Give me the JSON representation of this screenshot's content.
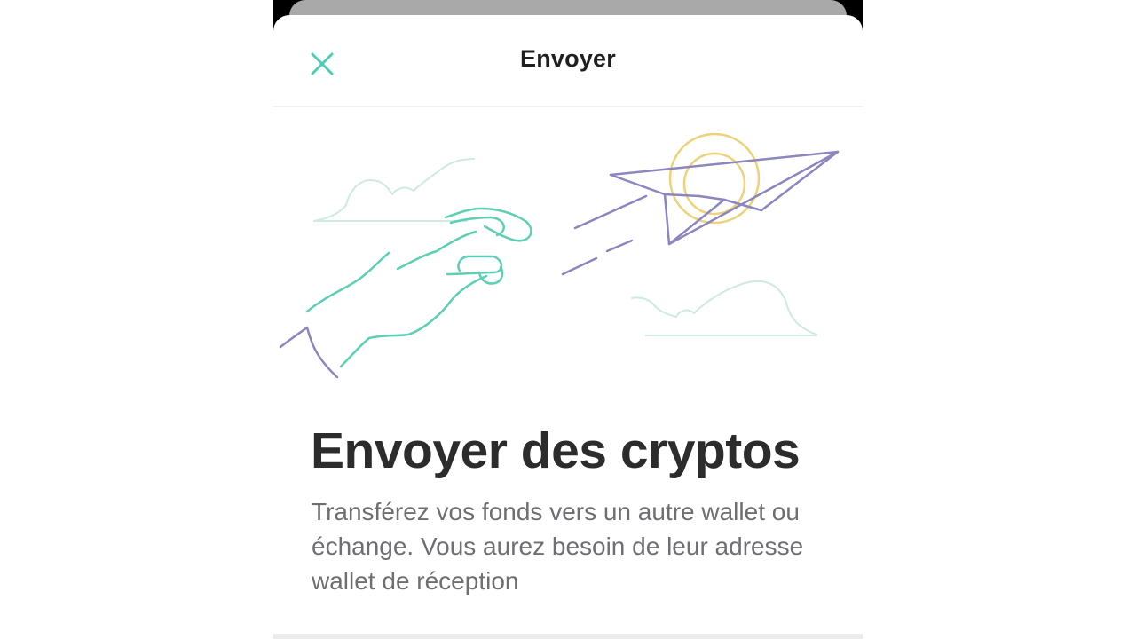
{
  "header": {
    "title": "Envoyer",
    "close_icon": "close-icon"
  },
  "illustration": {
    "icon": "send-crypto-illustration",
    "colors": {
      "hand": "#5ccfb4",
      "plane": "#8c86be",
      "coin": "#ecd27a",
      "cloud": "#cfe9e3"
    }
  },
  "main": {
    "headline": "Envoyer des cryptos",
    "description": "Transférez vos fonds vers un autre wallet ou échange. Vous aurez besoin de leur adresse wallet de réception"
  },
  "colors": {
    "accent": "#4ecdb4",
    "title": "#1f1f1f",
    "body_text": "#6e6e73"
  }
}
